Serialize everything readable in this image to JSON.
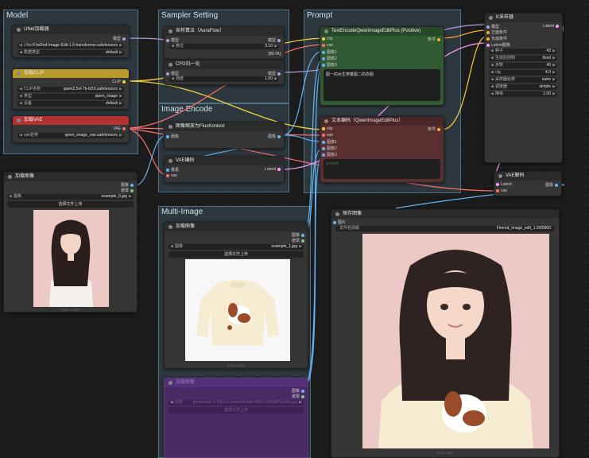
{
  "groups": {
    "model": "Model",
    "sampler": "Sampler Setting",
    "prompt": "Prompt",
    "image_encode": "Image Encode",
    "multi_image": "Multi-Image"
  },
  "unet": {
    "title": "UNet加载器",
    "out_model": "模型",
    "w1_label": "UNet",
    "w1_value": "FireRed-Image-Edit-1.0-transformer.safetensors",
    "w2_label": "数据类型",
    "w2_value": "default"
  },
  "clip_loader": {
    "title": "加载CLIP",
    "out_clip": "CLIP",
    "w1_label": "CLIP名称",
    "w1_value": "qwen2.5vl-7b-bf16.safetensors",
    "w2_label": "类型",
    "w2_value": "qwen_image",
    "w3_label": "设备",
    "w3_value": "default"
  },
  "vae_loader": {
    "title": "加载VAE",
    "out_vae": "VAE",
    "w1_label": "vae名称",
    "w1_value": "qwen_image_vae.safetensors"
  },
  "sampling_algo": {
    "title": "采样算法（AuraFlow）",
    "in_model": "模型",
    "out_model": "模型",
    "w1_label": "移位",
    "w1_value": "3.10",
    "badge": "[BETA]"
  },
  "cfg_norm": {
    "title": "CFG归一化",
    "in_model": "模型",
    "out_model": "模型",
    "w1_label": "强度",
    "w1_value": "1.00"
  },
  "pos_encode": {
    "title": "TextEncodeQwenImageEditPlus (Positive)",
    "in_clip": "clip",
    "in_vae": "vae",
    "in_img1": "图像1",
    "in_img2": "图像2",
    "in_img3": "图像3",
    "out_cond": "条件",
    "prompt": "图一的女生穿着图二的衣服"
  },
  "neg_encode": {
    "title": "文本编码（QwenImageEditPlus）",
    "in_clip": "clip",
    "in_vae": "vae",
    "in_img1": "图像1",
    "in_img2": "图像2",
    "in_img3": "图像3",
    "out_cond": "条件",
    "prompt": "prompt"
  },
  "ksampler": {
    "title": "K采样器",
    "in_model": "模型",
    "in_pos": "正面条件",
    "in_neg": "负面条件",
    "in_latent": "Latent图像",
    "out_latent": "Latent",
    "widgets": [
      {
        "label": "种子",
        "value": "43"
      },
      {
        "label": "生成后控制",
        "value": "fixed"
      },
      {
        "label": "步数",
        "value": "40"
      },
      {
        "label": "cfg",
        "value": "4.0"
      },
      {
        "label": "采样器名称",
        "value": "euler"
      },
      {
        "label": "调度器",
        "value": "simple"
      },
      {
        "label": "降噪",
        "value": "1.00"
      }
    ]
  },
  "flux_scale": {
    "title": "图像缩放为FluxKontext",
    "in_image": "图像",
    "out_image": "图像"
  },
  "vae_encode": {
    "title": "VAE编码",
    "in_pixels": "像素",
    "in_vae": "vae",
    "out_latent": "Latent"
  },
  "vae_decode": {
    "title": "VAE解码",
    "in_latent": "Latent",
    "in_vae": "vae",
    "out_image": "图像"
  },
  "load_img1": {
    "title": "加载图像",
    "out_image": "图像",
    "out_mask": "遮罩",
    "w_label": "图像",
    "w_value": "example_0.jpg",
    "upload": "选择文件上传",
    "caption": "1440 x 1920"
  },
  "load_img2": {
    "title": "加载图像",
    "out_image": "图像",
    "out_mask": "遮罩",
    "w_label": "图像",
    "w_value": "example_1.jpg",
    "upload": "选择文件上传",
    "caption": "1000 x 1000"
  },
  "load_img3": {
    "title": "加载图像",
    "out_image": "图像",
    "out_mask": "遮罩",
    "w_label": "图像",
    "w_value": "generated-17345.00-example-bad-5462-0026d8701b5c.jpg",
    "upload": "选择文件上传"
  },
  "save_img": {
    "title": "保存图像",
    "in_images": "图片",
    "w_label": "文件名前缀",
    "w_value": "Firered_Image_edit_1.0/00000",
    "caption": "864 x 1152"
  },
  "colors": {
    "clip_wire": "#f6d13a",
    "model_wire": "#b39ddb",
    "vae_wire": "#ff6e6e",
    "image_wire": "#64b5f6",
    "cond_wire": "#ffa931",
    "latent_wire": "#ff9cf9",
    "positive_node": "#2f5a32",
    "negative_node": "#5a2f2f",
    "clip_node": "#b79b2a",
    "vae_node": "#b33333",
    "purple_node": "#4a2a63"
  }
}
